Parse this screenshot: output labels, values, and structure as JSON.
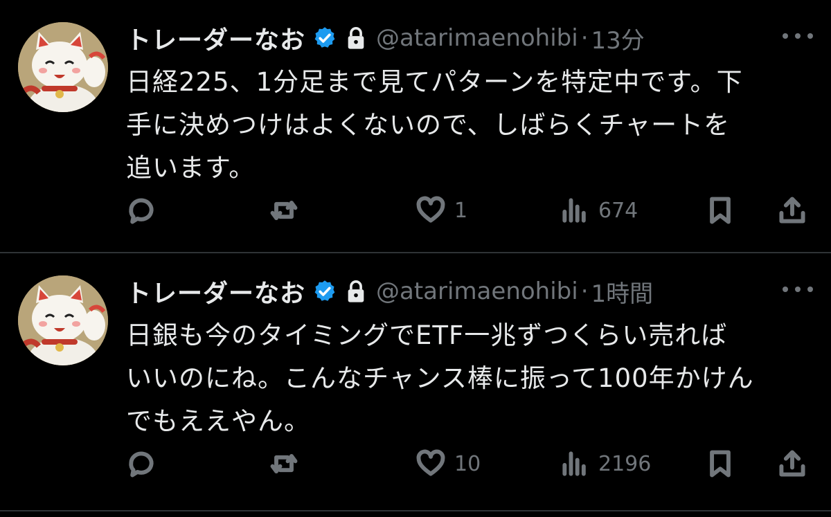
{
  "tweets": [
    {
      "display_name": "トレーダーなお",
      "handle": "@atarimaenohibi",
      "separator": "·",
      "time": "13分",
      "text_lines": [
        "日経225、1分足まで見てパターンを特定中です。下",
        "手に決めつけはよくないので、しばらくチャートを",
        "追います。"
      ],
      "reply_count": "",
      "retweet_count": "",
      "like_count": "1",
      "view_count": "674"
    },
    {
      "display_name": "トレーダーなお",
      "handle": "@atarimaenohibi",
      "separator": "·",
      "time": "1時間",
      "text_lines": [
        "日銀も今のタイミングでETF一兆ずつくらい売れば",
        "いいのにね。こんなチャンス棒に振って100年かけん",
        "でもええやん。"
      ],
      "reply_count": "",
      "retweet_count": "",
      "like_count": "10",
      "view_count": "2196"
    }
  ],
  "icons": {
    "verified": "verified-badge-icon",
    "lock": "lock-icon",
    "more": "more-options-icon",
    "reply": "reply-icon",
    "retweet": "retweet-icon",
    "like": "heart-icon",
    "views": "views-icon",
    "bookmark": "bookmark-icon",
    "share": "share-icon"
  },
  "colors": {
    "background": "#000000",
    "text_primary": "#e7e9ea",
    "text_secondary": "#71767b",
    "verified_blue": "#1d9bf0",
    "divider": "#2f3336"
  }
}
